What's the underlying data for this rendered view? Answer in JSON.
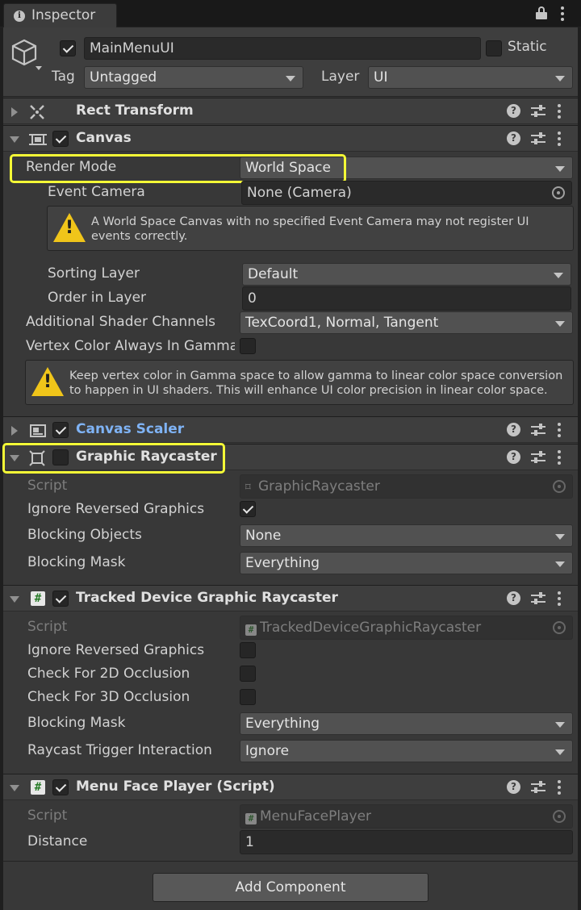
{
  "tab": {
    "title": "Inspector",
    "icon": "info-icon"
  },
  "object": {
    "name": "MainMenuUI",
    "active": true,
    "static_label": "Static",
    "static": false,
    "tag_label": "Tag",
    "tag_value": "Untagged",
    "layer_label": "Layer",
    "layer_value": "UI",
    "icon": "gameobject-cube-icon"
  },
  "components": {
    "rect_transform": {
      "title": "Rect Transform",
      "icon": "rect-transform-icon"
    },
    "canvas": {
      "title": "Canvas",
      "enabled": true,
      "render_mode_label": "Render Mode",
      "render_mode_value": "World Space",
      "event_camera_label": "Event Camera",
      "event_camera_value": "None (Camera)",
      "warning1": "A World Space Canvas with no specified Event Camera may not register UI events correctly.",
      "sorting_layer_label": "Sorting Layer",
      "sorting_layer_value": "Default",
      "order_label": "Order in Layer",
      "order_value": "0",
      "shader_channels_label": "Additional Shader Channels",
      "shader_channels_value": "TexCoord1, Normal, Tangent",
      "vertex_gamma_label": "Vertex Color Always In Gamma",
      "vertex_gamma": false,
      "warning2": "Keep vertex color in Gamma space to allow gamma to linear color space conversion to happen in UI shaders. This will enhance UI color precision in linear color space."
    },
    "canvas_scaler": {
      "title": "Canvas Scaler",
      "enabled": true
    },
    "graphic_raycaster": {
      "title": "Graphic Raycaster",
      "enabled": false,
      "script_label": "Script",
      "script_value": "GraphicRaycaster",
      "ignore_reversed_label": "Ignore Reversed Graphics",
      "ignore_reversed": true,
      "blocking_objects_label": "Blocking Objects",
      "blocking_objects_value": "None",
      "blocking_mask_label": "Blocking Mask",
      "blocking_mask_value": "Everything"
    },
    "tracked_device_raycaster": {
      "title": "Tracked Device Graphic Raycaster",
      "enabled": true,
      "script_label": "Script",
      "script_value": "TrackedDeviceGraphicRaycaster",
      "ignore_reversed_label": "Ignore Reversed Graphics",
      "check_2d_label": "Check For 2D Occlusion",
      "check_3d_label": "Check For 3D Occlusion",
      "blocking_mask_label": "Blocking Mask",
      "blocking_mask_value": "Everything",
      "raycast_trigger_label": "Raycast Trigger Interaction",
      "raycast_trigger_value": "Ignore"
    },
    "menu_face_player": {
      "title": "Menu Face Player (Script)",
      "enabled": true,
      "script_label": "Script",
      "script_value": "MenuFacePlayer",
      "distance_label": "Distance",
      "distance_value": "1"
    }
  },
  "add_component_label": "Add Component",
  "colors": {
    "highlight": "#f4fa36",
    "warning": "#f0c51a",
    "link_blue": "#7fb3f5"
  }
}
